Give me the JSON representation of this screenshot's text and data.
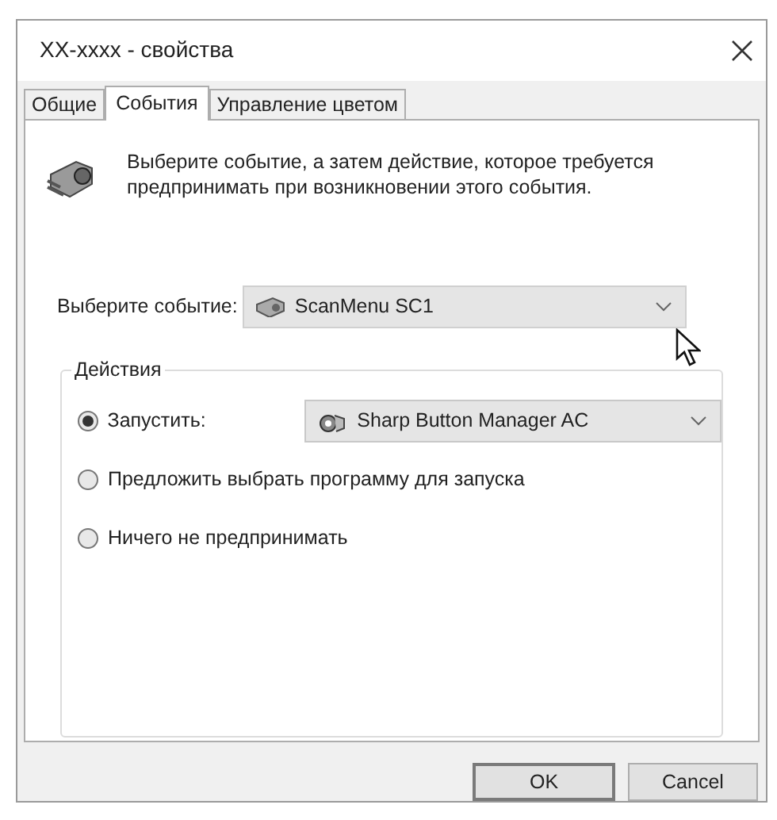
{
  "window": {
    "title": "XX-xxxx - свойства"
  },
  "tabs": [
    {
      "label": "Общие",
      "selected": false
    },
    {
      "label": "События",
      "selected": true
    },
    {
      "label": "Управление цветом",
      "selected": false
    }
  ],
  "description": "Выберите событие, а затем действие, которое требуется предпринимать при возникновении этого события.",
  "event_select": {
    "label": "Выберите событие:",
    "value": "ScanMenu SC1"
  },
  "actions": {
    "legend": "Действия",
    "options": [
      {
        "label": "Запустить:",
        "selected": true,
        "program": "Sharp Button Manager AC"
      },
      {
        "label": "Предложить выбрать программу для запуска",
        "selected": false
      },
      {
        "label": "Ничего не предпринимать",
        "selected": false
      }
    ]
  },
  "buttons": [
    {
      "label": "OK",
      "default": true
    },
    {
      "label": "Cancel",
      "default": false
    }
  ]
}
